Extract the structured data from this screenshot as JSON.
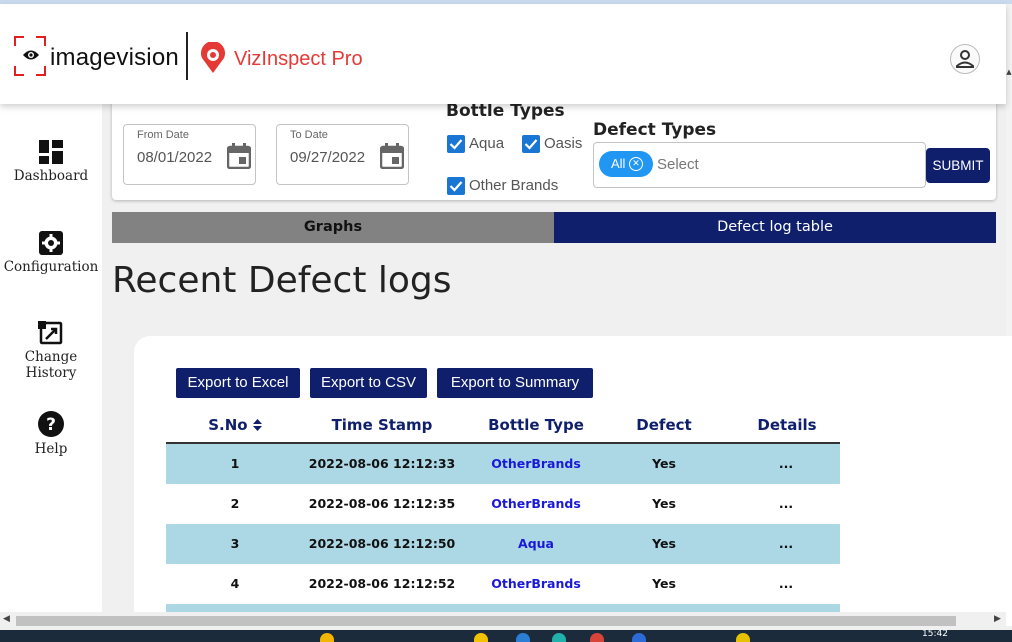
{
  "header": {
    "logo_imagevision": "imagevision",
    "logo_vizinspect": "VizInspect Pro"
  },
  "sidebar": {
    "items": [
      {
        "label": "Dashboard",
        "icon": "dashboard-icon"
      },
      {
        "label": "Configuration",
        "icon": "gear-icon"
      },
      {
        "label": "Change History",
        "icon": "history-icon"
      },
      {
        "label": "Help",
        "icon": "help-icon"
      }
    ]
  },
  "filters": {
    "from_date": {
      "label": "From Date",
      "value": "08/01/2022"
    },
    "to_date": {
      "label": "To Date",
      "value": "09/27/2022"
    },
    "bottle_types": {
      "title": "Bottle Types",
      "options": [
        {
          "label": "Aqua",
          "checked": true
        },
        {
          "label": "Oasis",
          "checked": true
        },
        {
          "label": "Other Brands",
          "checked": true
        }
      ]
    },
    "defect_types": {
      "title": "Defect Types",
      "chip": "All",
      "placeholder": "Select"
    },
    "submit_label": "SUBMIT"
  },
  "tabs": [
    {
      "label": "Graphs",
      "active": false
    },
    {
      "label": "Defect log table",
      "active": true
    }
  ],
  "main": {
    "title": "Recent Defect logs",
    "export_buttons": [
      "Export to Excel",
      "Export to CSV",
      "Export to Summary"
    ],
    "table": {
      "columns": [
        "S.No",
        "Time Stamp",
        "Bottle Type",
        "Defect",
        "Details"
      ],
      "rows": [
        {
          "sno": "1",
          "timestamp": "2022-08-06 12:12:33",
          "bottle_type": "OtherBrands",
          "defect": "Yes",
          "details": "..."
        },
        {
          "sno": "2",
          "timestamp": "2022-08-06 12:12:35",
          "bottle_type": "OtherBrands",
          "defect": "Yes",
          "details": "..."
        },
        {
          "sno": "3",
          "timestamp": "2022-08-06 12:12:50",
          "bottle_type": "Aqua",
          "defect": "Yes",
          "details": "..."
        },
        {
          "sno": "4",
          "timestamp": "2022-08-06 12:12:52",
          "bottle_type": "OtherBrands",
          "defect": "Yes",
          "details": "..."
        }
      ]
    }
  },
  "taskbar": {
    "clock": "15:42"
  },
  "colors": {
    "navy": "#0f1f6b",
    "row_shade": "#acd8e6",
    "checkbox": "#1976d2",
    "chip": "#2196f3",
    "brand_red": "#e53935"
  }
}
